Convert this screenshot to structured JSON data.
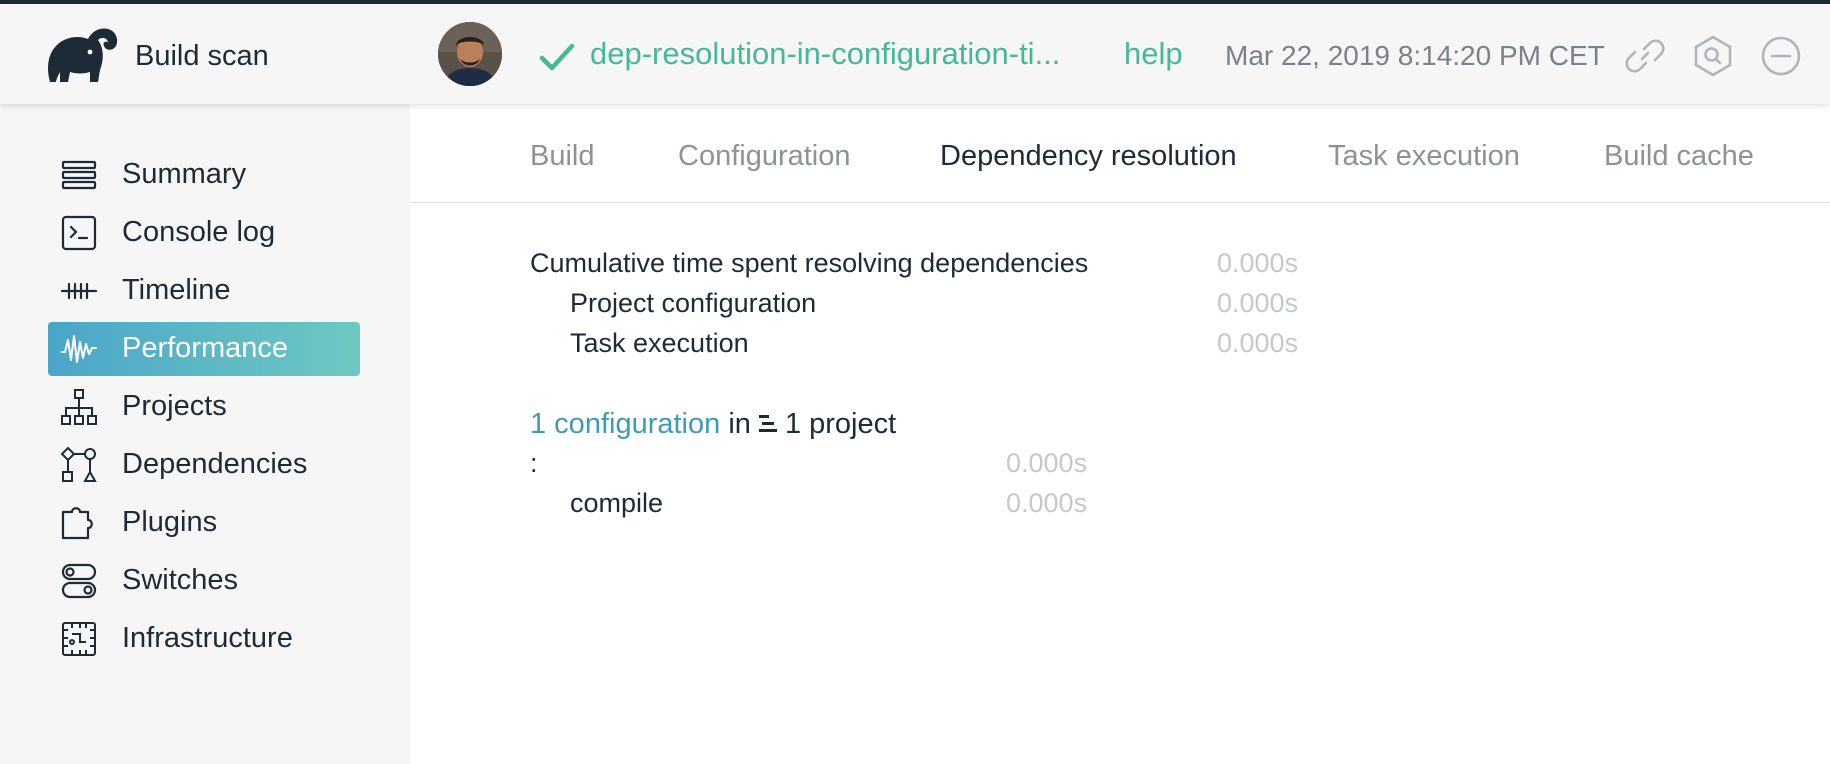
{
  "header": {
    "brand": "Build scan",
    "scan_name": "dep-resolution-in-configuration-ti...",
    "help": "help",
    "datetime": "Mar 22, 2019 8:14:20 PM CET"
  },
  "sidebar": {
    "items": [
      {
        "label": "Summary",
        "icon": "summary-icon"
      },
      {
        "label": "Console log",
        "icon": "console-icon"
      },
      {
        "label": "Timeline",
        "icon": "timeline-icon"
      },
      {
        "label": "Performance",
        "icon": "performance-icon",
        "active": true
      },
      {
        "label": "Projects",
        "icon": "projects-icon"
      },
      {
        "label": "Dependencies",
        "icon": "dependencies-icon"
      },
      {
        "label": "Plugins",
        "icon": "plugins-icon"
      },
      {
        "label": "Switches",
        "icon": "switches-icon"
      },
      {
        "label": "Infrastructure",
        "icon": "infrastructure-icon"
      }
    ]
  },
  "tabs": [
    {
      "label": "Build"
    },
    {
      "label": "Configuration"
    },
    {
      "label": "Dependency resolution",
      "active": true
    },
    {
      "label": "Task execution"
    },
    {
      "label": "Build cache"
    }
  ],
  "summary": {
    "cumulative_label": "Cumulative time spent resolving dependencies",
    "cumulative_value": "0.000s",
    "project_config_label": "Project configuration",
    "project_config_value": "0.000s",
    "task_exec_label": "Task execution",
    "task_exec_value": "0.000s"
  },
  "configs": {
    "count_link": "1 configuration",
    "in_text": "in",
    "project_count": "1 project",
    "project_label": ":",
    "project_value": "0.000s",
    "config_label": "compile",
    "config_value": "0.000s"
  },
  "colors": {
    "accent_green": "#45b894",
    "link_blue": "#3f9ab8",
    "active_gradient_start": "#4aa6c8",
    "active_gradient_end": "#6ec8c1"
  }
}
